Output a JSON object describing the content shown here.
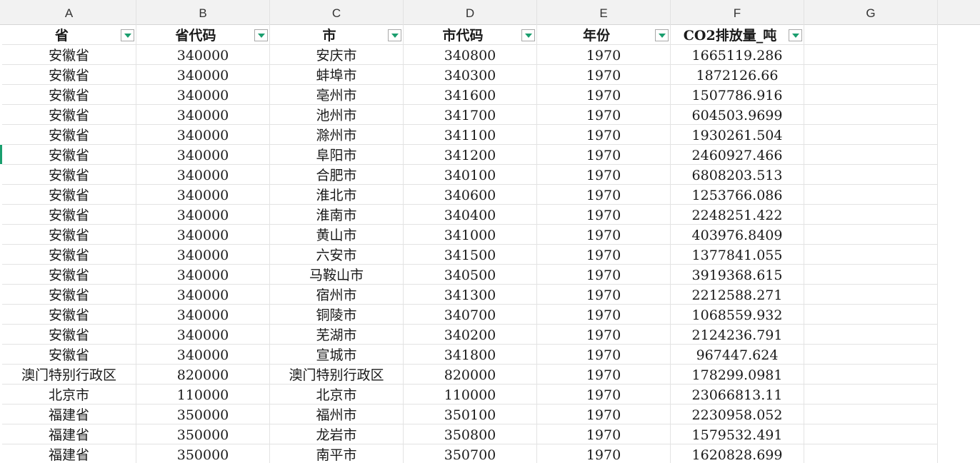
{
  "columns": [
    "A",
    "B",
    "C",
    "D",
    "E",
    "F",
    "G"
  ],
  "header_row": [
    "省",
    "省代码",
    "市",
    "市代码",
    "年份",
    "CO2排放量_吨"
  ],
  "rows": [
    [
      "安徽省",
      "340000",
      "安庆市",
      "340800",
      "1970",
      "1665119.286"
    ],
    [
      "安徽省",
      "340000",
      "蚌埠市",
      "340300",
      "1970",
      "1872126.66"
    ],
    [
      "安徽省",
      "340000",
      "亳州市",
      "341600",
      "1970",
      "1507786.916"
    ],
    [
      "安徽省",
      "340000",
      "池州市",
      "341700",
      "1970",
      "604503.9699"
    ],
    [
      "安徽省",
      "340000",
      "滁州市",
      "341100",
      "1970",
      "1930261.504"
    ],
    [
      "安徽省",
      "340000",
      "阜阳市",
      "341200",
      "1970",
      "2460927.466"
    ],
    [
      "安徽省",
      "340000",
      "合肥市",
      "340100",
      "1970",
      "6808203.513"
    ],
    [
      "安徽省",
      "340000",
      "淮北市",
      "340600",
      "1970",
      "1253766.086"
    ],
    [
      "安徽省",
      "340000",
      "淮南市",
      "340400",
      "1970",
      "2248251.422"
    ],
    [
      "安徽省",
      "340000",
      "黄山市",
      "341000",
      "1970",
      "403976.8409"
    ],
    [
      "安徽省",
      "340000",
      "六安市",
      "341500",
      "1970",
      "1377841.055"
    ],
    [
      "安徽省",
      "340000",
      "马鞍山市",
      "340500",
      "1970",
      "3919368.615"
    ],
    [
      "安徽省",
      "340000",
      "宿州市",
      "341300",
      "1970",
      "2212588.271"
    ],
    [
      "安徽省",
      "340000",
      "铜陵市",
      "340700",
      "1970",
      "1068559.932"
    ],
    [
      "安徽省",
      "340000",
      "芜湖市",
      "340200",
      "1970",
      "2124236.791"
    ],
    [
      "安徽省",
      "340000",
      "宣城市",
      "341800",
      "1970",
      "967447.624"
    ],
    [
      "澳门特别行政区",
      "820000",
      "澳门特别行政区",
      "820000",
      "1970",
      "178299.0981"
    ],
    [
      "北京市",
      "110000",
      "北京市",
      "110000",
      "1970",
      "23066813.11"
    ],
    [
      "福建省",
      "350000",
      "福州市",
      "350100",
      "1970",
      "2230958.052"
    ],
    [
      "福建省",
      "350000",
      "龙岩市",
      "350800",
      "1970",
      "1579532.491"
    ],
    [
      "福建省",
      "350000",
      "南平市",
      "350700",
      "1970",
      "1620828.699"
    ]
  ]
}
